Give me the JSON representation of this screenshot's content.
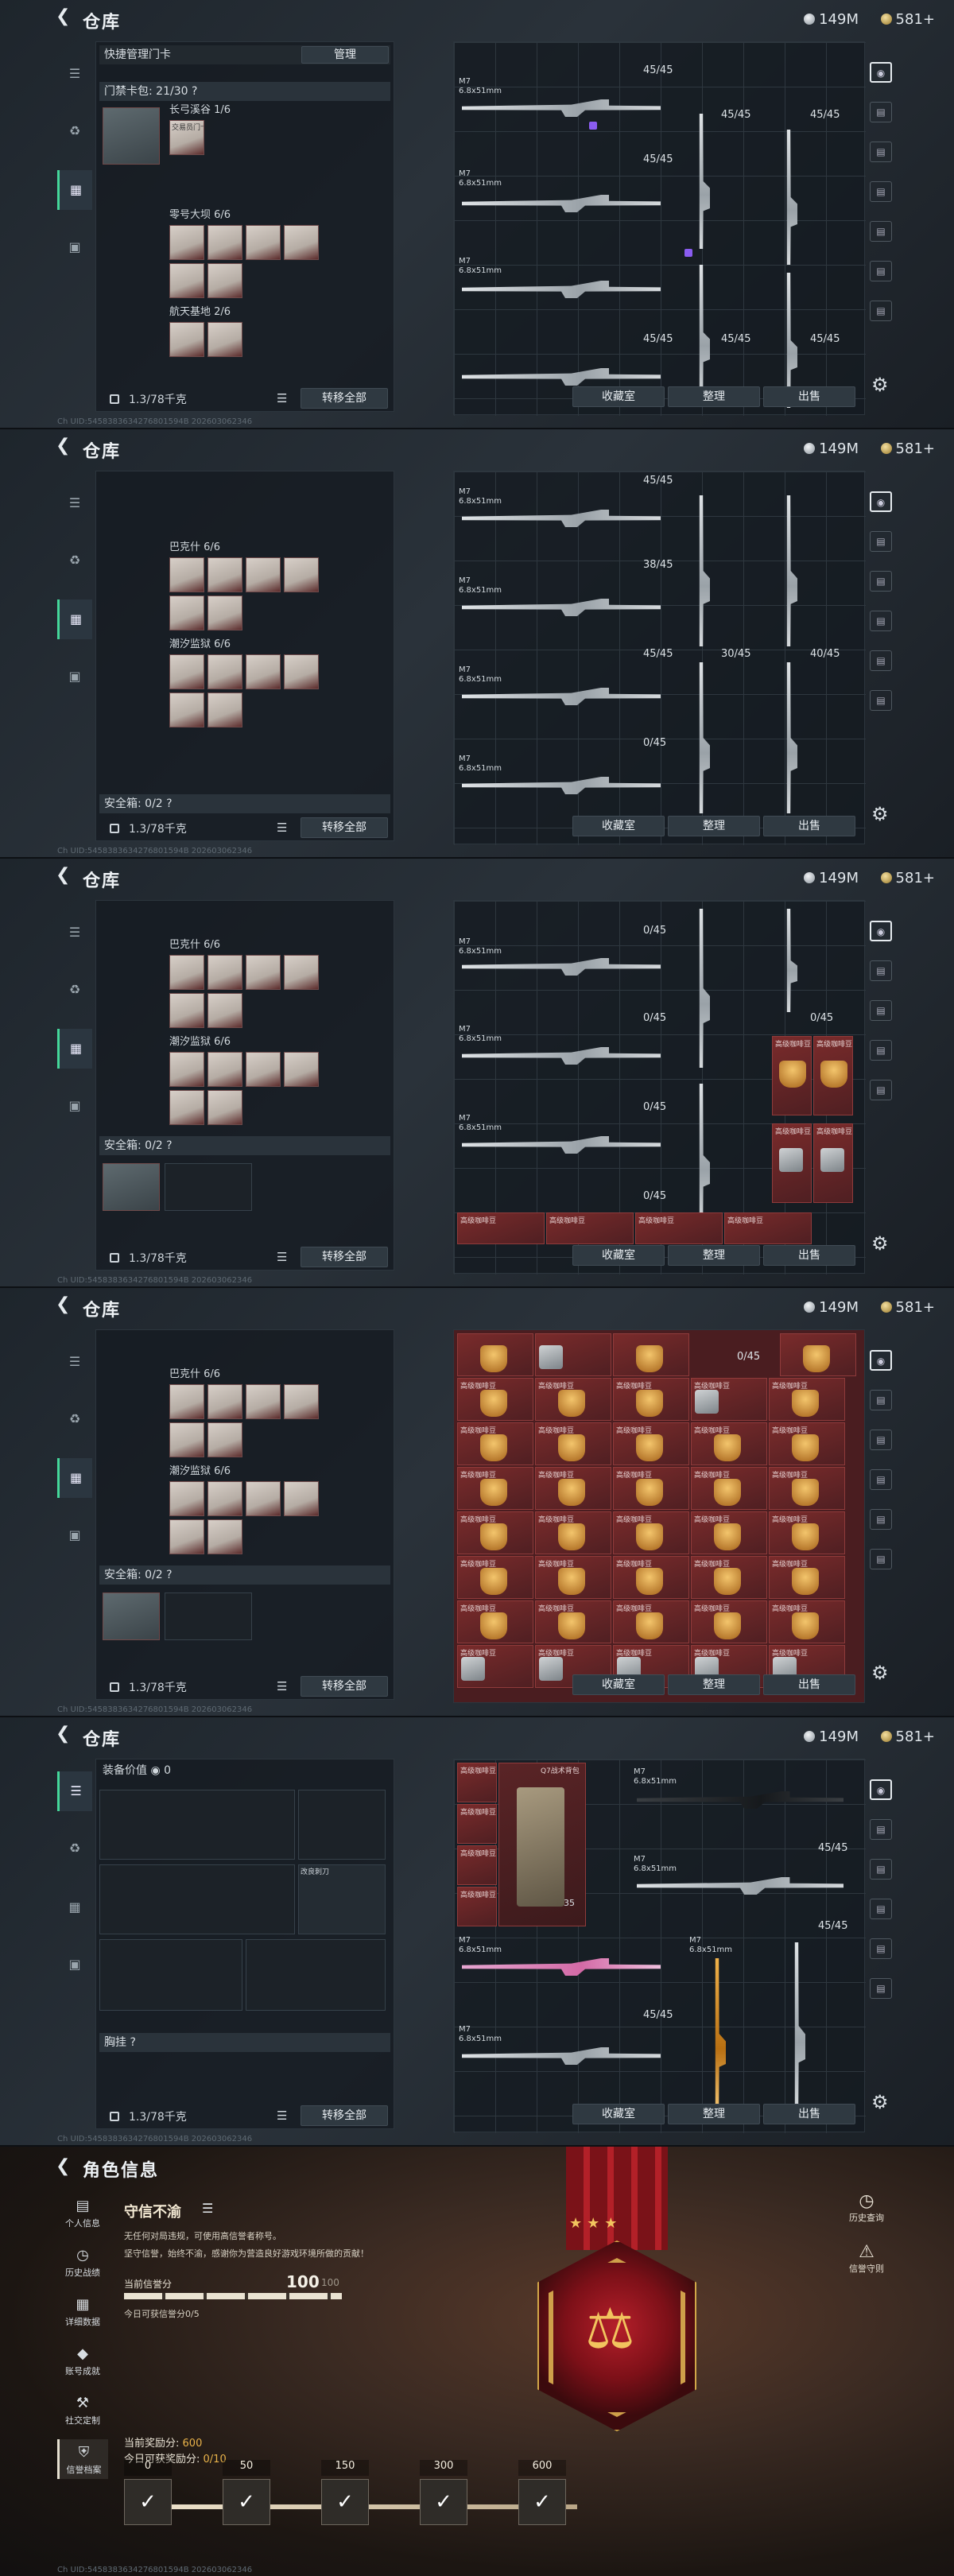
{
  "warehouse": {
    "title": "仓库",
    "currency_silver": "149M",
    "currency_gold": "581+",
    "status_line": "Ch UID:5458383634276801594B 202603062346",
    "capacity": "1.3/78千克",
    "transfer_all": "转移全部",
    "collection": "收藏室",
    "arrange": "整理",
    "sell": "出售",
    "manage": "管理",
    "quick_card": "快捷管理门卡",
    "access_pack": "门禁卡包: 21/30 ?",
    "group1": "长弓溪谷 1/6",
    "group2": "零号大坝 6/6",
    "group3": "航天基地 2/6",
    "group4": "巴克什 6/6",
    "group5": "潮汐监狱 6/6",
    "safebox": "安全箱: 0/2 ?",
    "equip_value": "装备价值",
    "equip_value_num": "0",
    "vest": "胸挂 ?",
    "gun_label": "M7",
    "gun_cal": "6.8x51mm",
    "ammo_full": "45/45",
    "ammo_38": "38/45",
    "ammo_30": "30/45",
    "ammo_40": "40/45",
    "ammo_empty": "0/45",
    "ammo_35": "35",
    "adv_item": "高级咖啡豆",
    "hp_item": "Q7战术背包",
    "tag_slot": "交易员门卡",
    "equip_item": "改良刺刀"
  },
  "char": {
    "title": "角色信息",
    "nav": [
      "个人信息",
      "历史战绩",
      "详细数据",
      "账号成就",
      "社交定制",
      "信誉档案"
    ],
    "honor_title": "守信不渝",
    "desc1": "无任何对局违规，可使用高信誉者称号。",
    "desc2": "坚守信誉，始终不渝，感谢你为营造良好游戏环境所做的贡献！",
    "score_label": "当前信誉分",
    "score_value": "100",
    "score_max": "100",
    "today_score": "今日可获信誉分0/5",
    "reward_label": "当前奖励分:",
    "reward_value": "600",
    "today_reward_label": "今日可获奖励分:",
    "today_reward_value": "0/10",
    "tiers": [
      "0",
      "50",
      "150",
      "300",
      "600"
    ],
    "history_query": "历史查询",
    "credit_guard": "信誉守则",
    "status_line": "Ch UID:5458383634276801594B 202603062346"
  },
  "colors": {
    "accent": "#44d79a",
    "gold": "#e8b24a",
    "purple": "#8a5cf0",
    "red": "#7a2b2b"
  }
}
